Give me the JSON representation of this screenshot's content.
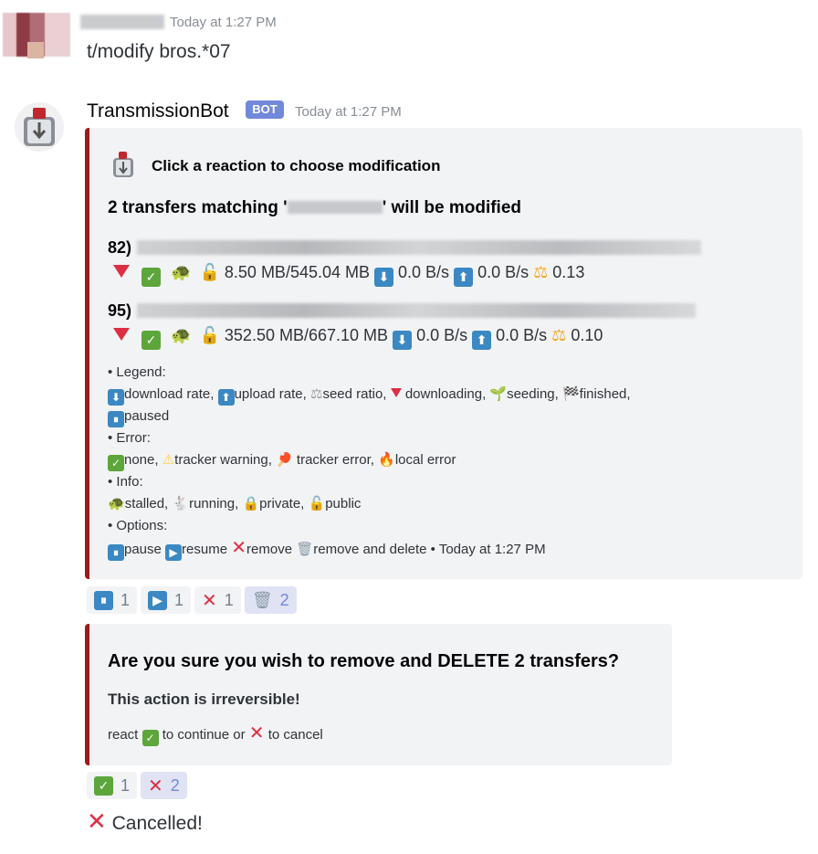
{
  "messages": {
    "first": {
      "timestamp": "Today at 1:27 PM",
      "text": "t/modify bros.*07"
    },
    "bot": {
      "name": "TransmissionBot",
      "tag": "BOT",
      "timestamp": "Today at 1:27 PM"
    }
  },
  "embed1": {
    "author": "Click a reaction to choose modification",
    "title_prefix": "2 transfers matching '",
    "title_suffix": "' will be modified",
    "transfers": [
      {
        "id": "82)",
        "size": "8.50 MB/545.04 MB",
        "down": "0.0 B/s",
        "up": "0.0 B/s",
        "ratio": "0.13"
      },
      {
        "id": "95)",
        "size": "352.50 MB/667.10 MB",
        "down": "0.0 B/s",
        "up": "0.0 B/s",
        "ratio": "0.10"
      }
    ],
    "legend": {
      "legend_head": "• Legend:",
      "download": "download rate,",
      "upload": "upload rate,",
      "seed": "seed ratio,",
      "downloading": "downloading,",
      "seeding": "seeding,",
      "finished": "finished,",
      "paused": "paused",
      "error_head": "• Error:",
      "none": "none,",
      "tracker_warning": "tracker warning,",
      "tracker_error": "tracker error,",
      "local_error": "local error",
      "info_head": "• Info:",
      "stalled": "stalled,",
      "running": "running,",
      "private": "private,",
      "public": "public",
      "options_head": "• Options:",
      "pause": "pause",
      "resume": "resume",
      "remove": "remove",
      "remove_delete": "remove and delete",
      "footer": " • Today at 1:27 PM"
    }
  },
  "reactions1": [
    {
      "icon": "pause-icon",
      "count": "1"
    },
    {
      "icon": "play-icon",
      "count": "1"
    },
    {
      "icon": "x-icon",
      "count": "1"
    },
    {
      "icon": "wastebasket-icon",
      "count": "2"
    }
  ],
  "embed2": {
    "title": "Are you sure you wish to remove and DELETE 2 transfers?",
    "subtitle": "This action is irreversible!",
    "react": "react",
    "continue": "to continue or",
    "cancel": "to cancel"
  },
  "reactions2": [
    {
      "icon": "check-icon",
      "count": "1"
    },
    {
      "icon": "x-icon",
      "count": "2"
    }
  ],
  "cancelled": "Cancelled!",
  "colors": {
    "embed_border": "#a0191b",
    "bot_tag": "#7289da",
    "active_reaction": "#dfe3f4"
  }
}
